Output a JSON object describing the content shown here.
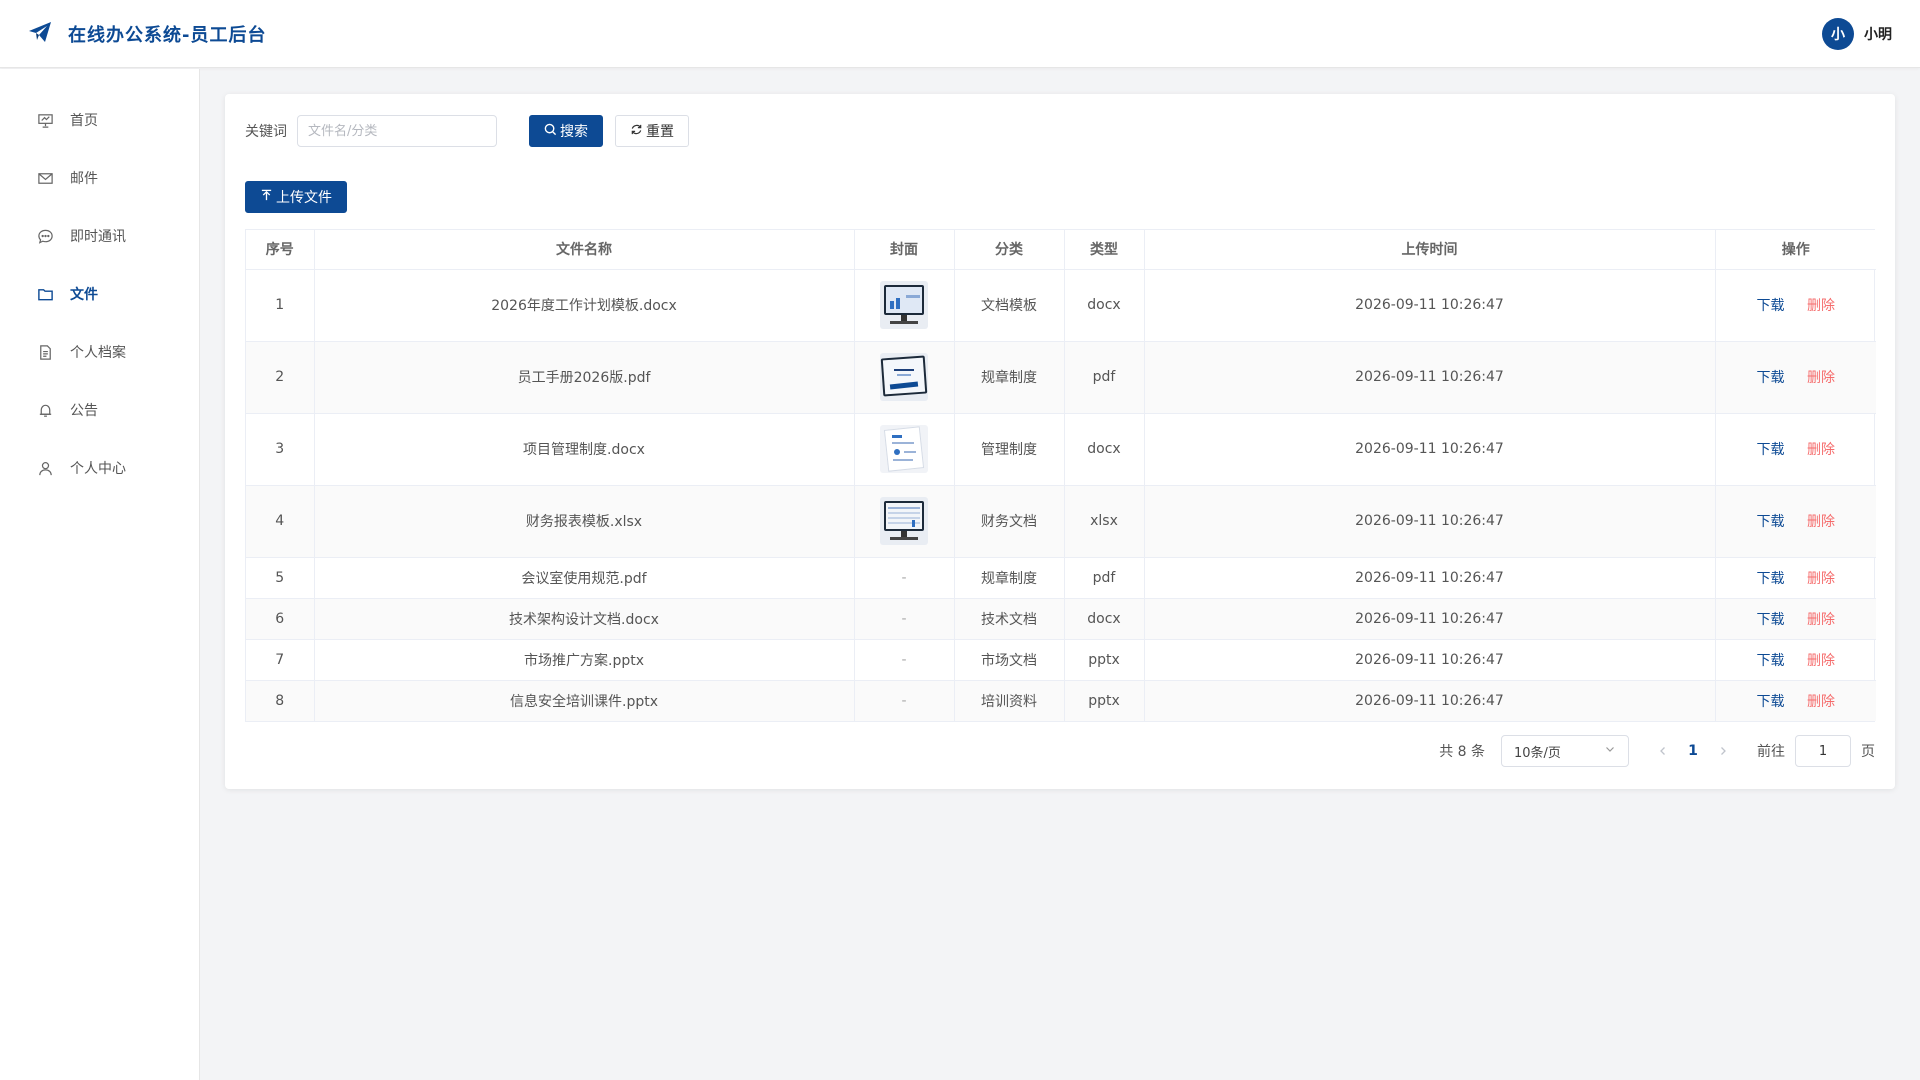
{
  "header": {
    "title": "在线办公系统-员工后台",
    "user_avatar": "小",
    "user_name": "小明"
  },
  "sidebar": {
    "items": [
      {
        "label": "首页",
        "icon": "home-icon",
        "active": false
      },
      {
        "label": "邮件",
        "icon": "mail-icon",
        "active": false
      },
      {
        "label": "即时通讯",
        "icon": "chat-icon",
        "active": false
      },
      {
        "label": "文件",
        "icon": "folder-icon",
        "active": true
      },
      {
        "label": "个人档案",
        "icon": "document-icon",
        "active": false
      },
      {
        "label": "公告",
        "icon": "bell-icon",
        "active": false
      },
      {
        "label": "个人中心",
        "icon": "user-icon",
        "active": false
      }
    ]
  },
  "search": {
    "label": "关键词",
    "placeholder": "文件名/分类",
    "value": "",
    "search_button": "搜索",
    "reset_button": "重置",
    "upload_button": "上传文件"
  },
  "table": {
    "columns": [
      "序号",
      "文件名称",
      "封面",
      "分类",
      "类型",
      "上传时间",
      "操作"
    ],
    "rows": [
      {
        "no": "1",
        "name": "2026年度工作计划模板.docx",
        "cover": "monitor-dashboard",
        "category": "文档模板",
        "type": "docx",
        "time": "2026-09-11 10:26:47"
      },
      {
        "no": "2",
        "name": "员工手册2026版.pdf",
        "cover": "laptop-document",
        "category": "规章制度",
        "type": "pdf",
        "time": "2026-09-11 10:26:47"
      },
      {
        "no": "3",
        "name": "项目管理制度.docx",
        "cover": "paper-chart",
        "category": "管理制度",
        "type": "docx",
        "time": "2026-09-11 10:26:47"
      },
      {
        "no": "4",
        "name": "财务报表模板.xlsx",
        "cover": "monitor-spreadsheet",
        "category": "财务文档",
        "type": "xlsx",
        "time": "2026-09-11 10:26:47"
      },
      {
        "no": "5",
        "name": "会议室使用规范.pdf",
        "cover": "-",
        "category": "规章制度",
        "type": "pdf",
        "time": "2026-09-11 10:26:47"
      },
      {
        "no": "6",
        "name": "技术架构设计文档.docx",
        "cover": "-",
        "category": "技术文档",
        "type": "docx",
        "time": "2026-09-11 10:26:47"
      },
      {
        "no": "7",
        "name": "市场推广方案.pptx",
        "cover": "-",
        "category": "市场文档",
        "type": "pptx",
        "time": "2026-09-11 10:26:47"
      },
      {
        "no": "8",
        "name": "信息安全培训课件.pptx",
        "cover": "-",
        "category": "培训资料",
        "type": "pptx",
        "time": "2026-09-11 10:26:47"
      }
    ],
    "download_label": "下载",
    "delete_label": "删除"
  },
  "pagination": {
    "total": "共 8 条",
    "page_size": "10条/页",
    "current_page": "1",
    "goto_label": "前往",
    "goto_value": "1",
    "goto_suffix": "页"
  },
  "colors": {
    "primary": "#0d4a94",
    "danger": "#f56c6c"
  }
}
